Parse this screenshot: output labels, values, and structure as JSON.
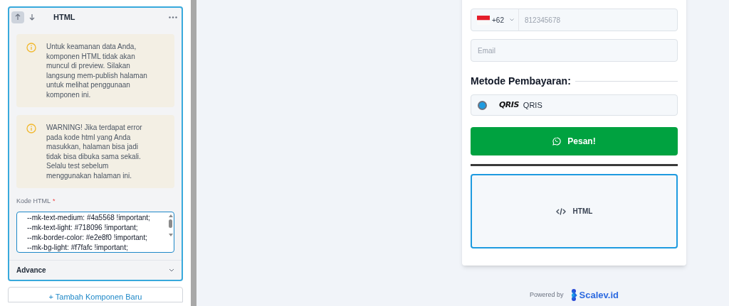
{
  "component_panel": {
    "title": "HTML",
    "move_up_active": true,
    "notices": [
      {
        "text": "Untuk keamanan data Anda, komponen HTML tidak akan muncul di preview. Silakan langsung mem-publish halaman untuk melihat penggunaan komponen ini."
      },
      {
        "text": "WARNING! Jika terdapat error pada kode html yang Anda masukkan, halaman bisa jadi tidak bisa dibuka sama sekali. Selalu test sebelum menggunakan halaman ini."
      }
    ],
    "code_field": {
      "label": "Kode HTML",
      "required_mark": "*",
      "lines": [
        "--mk-text-medium: #4a5568 !important;",
        "--mk-text-light: #718096 !important;",
        "--mk-border-color: #e2e8f0 !important;",
        "--mk-bg-light: #f7fafc !important;"
      ]
    },
    "advance": {
      "label": "Advance",
      "expanded": false
    }
  },
  "add_button": "+ Tambah Komponen Baru",
  "preview": {
    "phone_field": {
      "country_code": "+62",
      "placeholder": "812345678"
    },
    "email_field": {
      "placeholder": "Email"
    },
    "payment_heading": "Metode Pembayaran:",
    "payment_options": [
      {
        "logo": "QRIS",
        "label": "QRIS",
        "selected": true
      }
    ],
    "order_button": "Pesan!",
    "html_block": {
      "label": "HTML",
      "selected": true
    }
  },
  "footer": {
    "powered_by": "Powered by",
    "brand": "Scalev.id"
  }
}
